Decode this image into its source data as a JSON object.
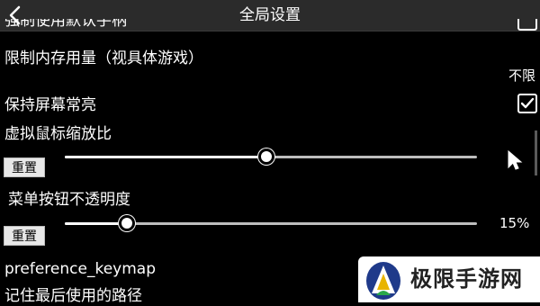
{
  "header": {
    "title": "全局设置"
  },
  "settings": {
    "clipped_row": "强制使用默认手柄",
    "memory_limit": {
      "label": "限制内存用量（视具体游戏）",
      "value": "不限"
    },
    "keep_screen_on": {
      "label": "保持屏幕常亮",
      "checked": true
    },
    "cursor_scale": {
      "label": "虚拟鼠标缩放比",
      "reset": "重置",
      "level": 0.49
    },
    "button_opacity": {
      "label": "菜单按钮不透明度",
      "reset": "重置",
      "value": "15%",
      "level": 0.15
    },
    "keymap": {
      "label": "preference_keymap"
    },
    "remember_path": {
      "label": "记住最后使用的路径"
    }
  },
  "watermark": {
    "text": "极限手游网"
  },
  "icons": [
    "back-arrow-icon",
    "checkbox-check-icon",
    "mouse-cursor-icon",
    "watermark-logo-icon"
  ]
}
